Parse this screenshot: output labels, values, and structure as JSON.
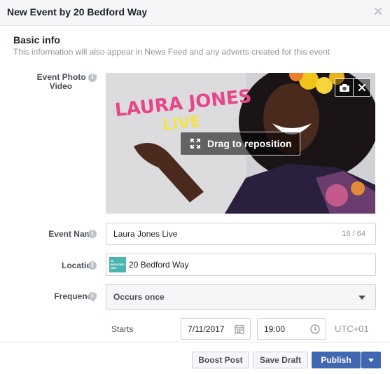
{
  "dialog": {
    "title": "New Event by 20 Bedford Way"
  },
  "section": {
    "title": "Basic info",
    "subtitle": "This information will also appear in News Feed and any adverts created for this event"
  },
  "photo": {
    "label_line1": "Event Photo or",
    "label_line2": "Video",
    "overlay_text_1": "LAURA JONES",
    "overlay_text_2": "LIVE",
    "drag_label": "Drag to reposition"
  },
  "event_name": {
    "label": "Event Name",
    "value": "Laura Jones Live",
    "counter": "16 / 64"
  },
  "location": {
    "label": "Location",
    "value": "20 Bedford Way",
    "thumb_text": "20 BEDFORD WAY"
  },
  "frequency": {
    "label": "Frequency",
    "value": "Occurs once"
  },
  "starts": {
    "label": "Starts",
    "date": "7/11/2017",
    "time": "19:00",
    "timezone": "UTC+01"
  },
  "buttons": {
    "boost": "Boost Post",
    "save_draft": "Save Draft",
    "publish": "Publish"
  },
  "colors": {
    "primary": "#4267b2",
    "header_bg": "#f5f6f7",
    "muted": "#90949c",
    "pink_title": "#e8458b",
    "yellow_live": "#f3e24a"
  }
}
